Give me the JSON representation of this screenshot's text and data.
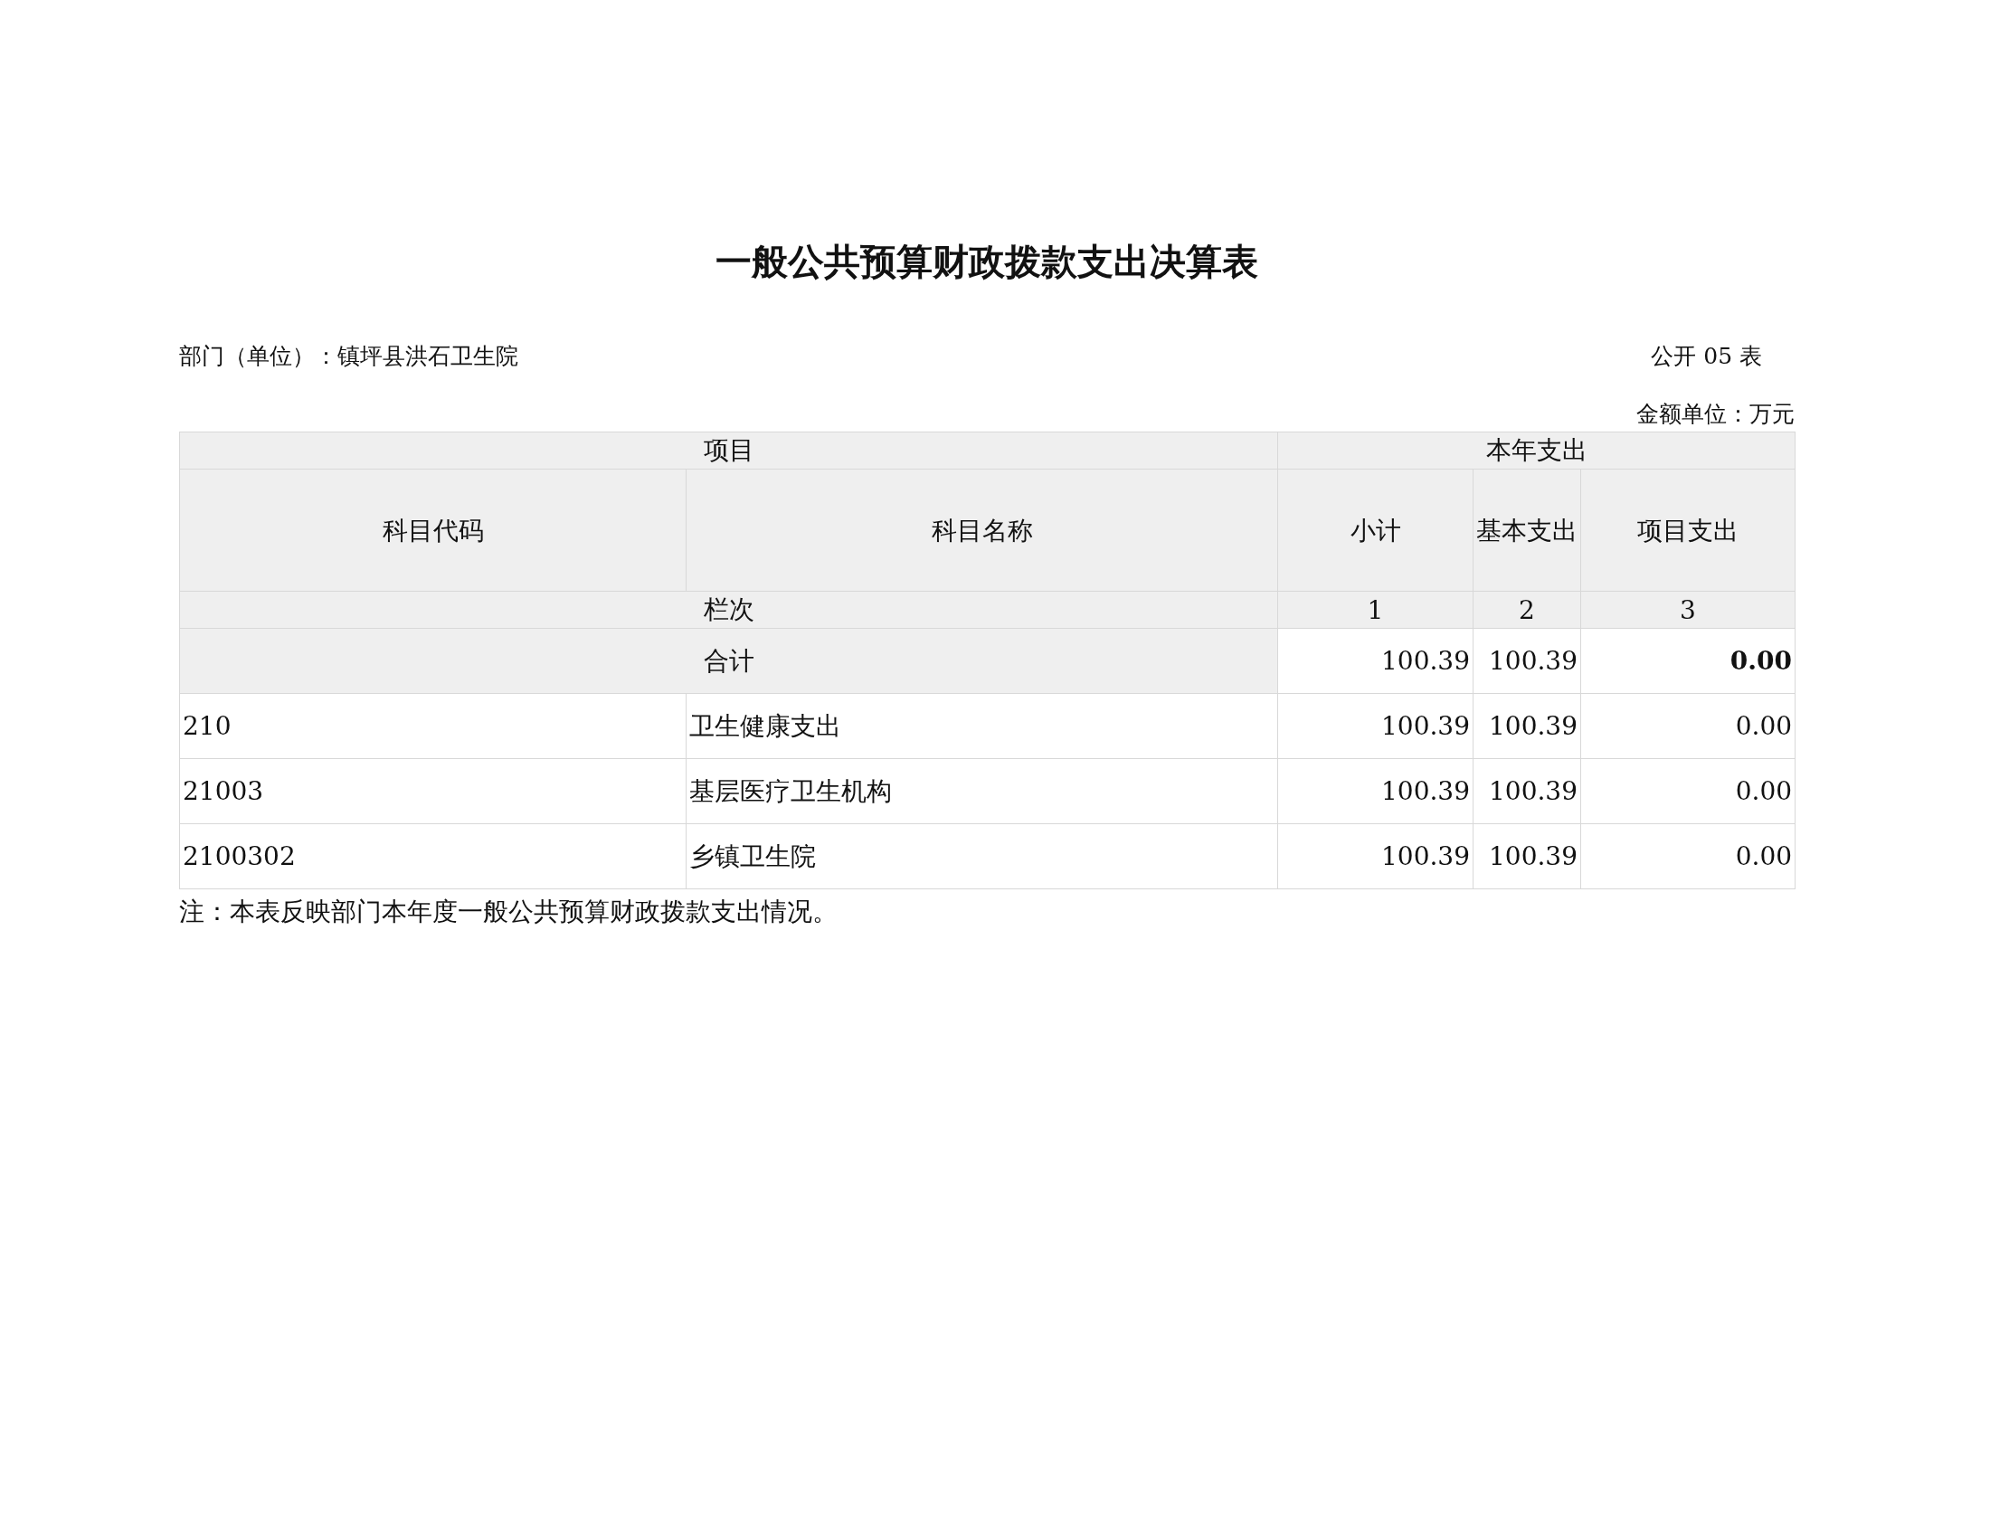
{
  "title": "一般公共预算财政拨款支出决算表",
  "department": "部门（单位）：镇坪县洪石卫生院",
  "table_number": "公开 05 表",
  "unit": "金额单位：万元",
  "table": {
    "group_headers": [
      "项目",
      "本年支出"
    ],
    "columns": [
      "科目代码",
      "科目名称",
      "小计",
      "基本支出",
      "项目支出"
    ],
    "index_row": {
      "label": "栏次",
      "values": [
        "1",
        "2",
        "3"
      ]
    },
    "total_row": {
      "label": "合计",
      "values": [
        "100.39",
        "100.39",
        "0.00"
      ]
    },
    "rows": [
      {
        "code": "210",
        "name": "卫生健康支出",
        "values": [
          "100.39",
          "100.39",
          "0.00"
        ]
      },
      {
        "code": "21003",
        "name": "基层医疗卫生机构",
        "values": [
          "100.39",
          "100.39",
          "0.00"
        ]
      },
      {
        "code": "2100302",
        "name": "乡镇卫生院",
        "values": [
          "100.39",
          "100.39",
          "0.00"
        ]
      }
    ]
  },
  "note": "注：本表反映部门本年度一般公共预算财政拨款支出情况。"
}
